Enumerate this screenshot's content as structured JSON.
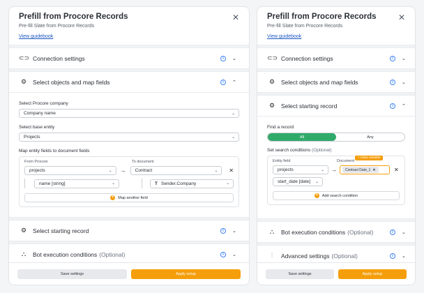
{
  "left": {
    "title": "Prefill from Procore Records",
    "subtitle": "Pre-fill Slate from Procore Records",
    "guidebook": "View guidebook",
    "sections": {
      "connection": "Connection settings",
      "select_objects": "Select objects and map fields",
      "starting_record": "Select starting record",
      "bot_conditions": "Bot execution conditions",
      "optional": "(Optional)"
    },
    "company_label": "Select Procore company",
    "company_value": "Company name",
    "entity_label": "Select base entity",
    "entity_value": "Projects",
    "map_label": "Map entity fields to document fields",
    "from_label": "From Procore",
    "to_label": "To document",
    "from_value": "projects",
    "to_value": "Contract",
    "sub_from": "name [string]",
    "sub_to": "Sender.Company",
    "to_icon": "T",
    "map_another": "Map another field",
    "save": "Save settings",
    "apply": "Apply setup"
  },
  "right": {
    "title": "Prefill from Procore Records",
    "subtitle": "Pre-fill Slate from Procore Records",
    "guidebook": "View guidebook",
    "sections": {
      "connection": "Connection settings",
      "select_objects": "Select objects and map fields",
      "starting_record": "Select starting record",
      "bot_conditions": "Bot execution conditions",
      "advanced": "Advanced settings",
      "optional": "(Optional)"
    },
    "find_label": "Find a record",
    "toggle_all": "All",
    "toggle_any": "Any",
    "search_label": "Set search conditions",
    "search_optional": "(Optional)",
    "entity_field": "Entity field",
    "document_label": "Document",
    "tooltip": "+ Data variable",
    "entity_value": "projects",
    "chip": "Contract Date_1",
    "sub_value": "start_date [date]",
    "add_condition": "Add search condition",
    "save": "Save settings",
    "apply": "Apply setup"
  },
  "icons": {
    "link": "link-icon",
    "gear": "gear-icon",
    "tree": "tree-icon",
    "sliders": "sliders-icon",
    "info": "info-icon",
    "chevron": "chevron-icon",
    "close": "close-icon"
  },
  "colors": {
    "accent": "#f59e0b",
    "green": "#2faa6a",
    "info": "#3b82f6",
    "link": "#1a56c4"
  }
}
